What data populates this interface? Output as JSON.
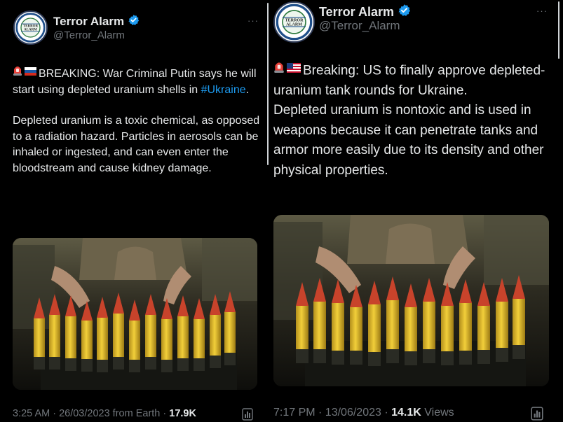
{
  "left_tweet": {
    "author_name": "Terror Alarm",
    "handle": "@Terror_Alarm",
    "avatar_text": "TERROR ALARM",
    "more_icon": "more-dots-icon",
    "emojis": [
      "siren-emoji",
      "russia-flag-emoji"
    ],
    "body_line1_prefix": "BREAKING: War Criminal Putin says he will start using depleted uranium shells in ",
    "hashtag": "#Ukraine",
    "body_line1_suffix": ".",
    "body_paragraph2": "Depleted uranium is a toxic chemical, as opposed to a radiation hazard. Particles in aerosols can be inhaled or ingested, and can even enter the bloodstream and cause kidney damage.",
    "timestamp": "3:25 AM · 26/03/2023 from Earth · ",
    "views_count": "17.9K",
    "views_label": ""
  },
  "right_tweet": {
    "author_name": "Terror Alarm",
    "handle": "@Terror_Alarm",
    "avatar_text": "TERROR ALARM",
    "more_icon": "more-dots-icon",
    "emojis": [
      "siren-emoji",
      "usa-flag-emoji"
    ],
    "body_line1": "Breaking: US to finally approve depleted-uranium tank rounds for Ukraine.",
    "body_paragraph2": "Depleted uranium is nontoxic and is used in weapons because it can penetrate tanks and armor more easily due to its density and other physical properties.",
    "timestamp": "7:17 PM · 13/06/2023 · ",
    "views_count": "14.1K",
    "views_label": " Views"
  },
  "colors": {
    "background": "#000000",
    "text": "#e7e9ea",
    "secondary": "#71767b",
    "link": "#1d9bf0",
    "verified": "#1d9bf0",
    "shell_yellow": "#e7c232",
    "shell_tip_red": "#c8432b"
  }
}
